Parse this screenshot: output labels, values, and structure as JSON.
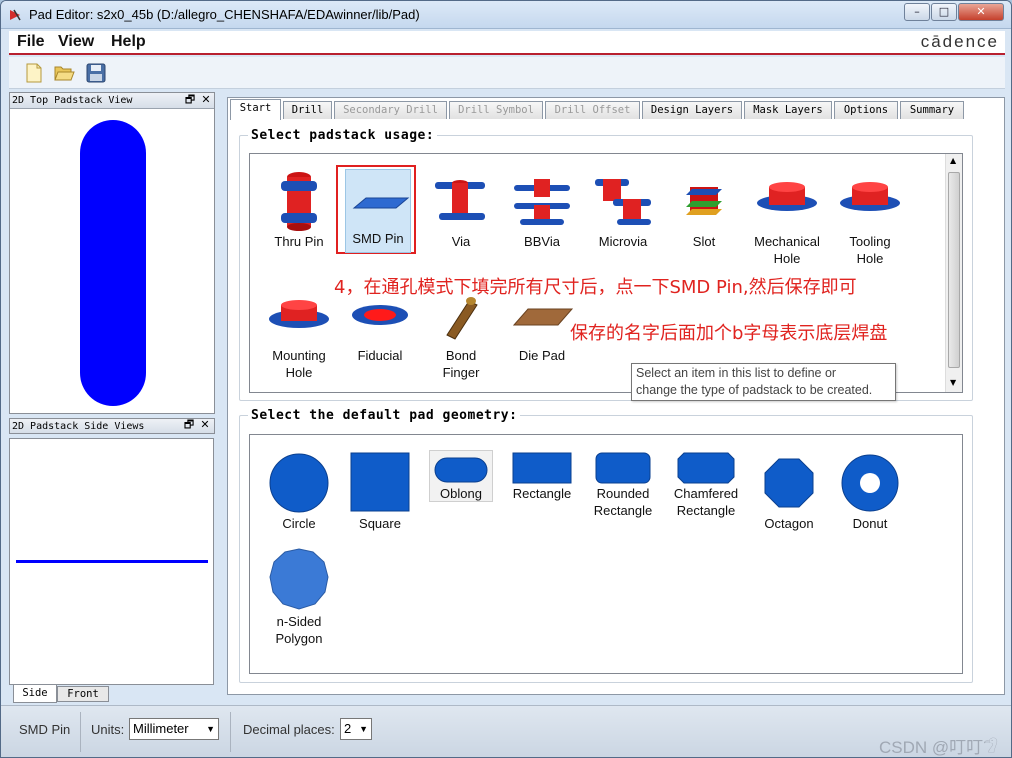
{
  "window": {
    "title": "Pad Editor: s2x0_45b  (D:/allegro_CHENSHAFA/EDAwinner/lib/Pad)",
    "minimize": "–",
    "maximize": "□",
    "close": "✕"
  },
  "menu": {
    "file": "File",
    "view": "View",
    "help": "Help",
    "brand": "cādence"
  },
  "toolbar": {
    "new_icon": "new-document-icon",
    "open_icon": "open-folder-icon",
    "save_icon": "save-disk-icon"
  },
  "top_view": {
    "title": "2D Top Padstack View",
    "restore": "🗗",
    "close": "✕",
    "pad_color": "#0000ff"
  },
  "side_view": {
    "title": "2D Padstack Side Views",
    "restore": "🗗",
    "close": "✕",
    "tabs": [
      "Side",
      "Front"
    ],
    "line_color": "#0000ff"
  },
  "tabs": [
    {
      "label": "Start",
      "state": "active"
    },
    {
      "label": "Drill",
      "state": "normal"
    },
    {
      "label": "Secondary Drill",
      "state": "disabled"
    },
    {
      "label": "Drill Symbol",
      "state": "disabled"
    },
    {
      "label": "Drill Offset",
      "state": "disabled"
    },
    {
      "label": "Design Layers",
      "state": "normal"
    },
    {
      "label": "Mask Layers",
      "state": "normal"
    },
    {
      "label": "Options",
      "state": "normal"
    },
    {
      "label": "Summary",
      "state": "normal"
    }
  ],
  "usage": {
    "title": "Select padstack usage:",
    "items": [
      {
        "l1": "Thru Pin",
        "l2": ""
      },
      {
        "l1": "SMD Pin",
        "l2": "",
        "selected": true
      },
      {
        "l1": "Via",
        "l2": ""
      },
      {
        "l1": "BBVia",
        "l2": ""
      },
      {
        "l1": "Microvia",
        "l2": ""
      },
      {
        "l1": "Slot",
        "l2": ""
      },
      {
        "l1": "Mechanical",
        "l2": "Hole"
      },
      {
        "l1": "Tooling",
        "l2": "Hole"
      },
      {
        "l1": "Mounting",
        "l2": "Hole"
      },
      {
        "l1": "Fiducial",
        "l2": ""
      },
      {
        "l1": "Bond",
        "l2": "Finger"
      },
      {
        "l1": "Die Pad",
        "l2": ""
      }
    ],
    "tooltip_line1": "Select an item in this list to define or",
    "tooltip_line2": "change the type of padstack to be created."
  },
  "annotations": {
    "line1": "4，在通孔模式下填完所有尺寸后，点一下SMD Pin,然后保存即可",
    "line2": "保存的名字后面加个b字母表示底层焊盘",
    "color": "#e0231f"
  },
  "geometry": {
    "title": "Select the default pad geometry:",
    "items": [
      {
        "l1": "Circle",
        "l2": ""
      },
      {
        "l1": "Square",
        "l2": ""
      },
      {
        "l1": "Oblong",
        "l2": "",
        "selected": true
      },
      {
        "l1": "Rectangle",
        "l2": ""
      },
      {
        "l1": "Rounded",
        "l2": "Rectangle"
      },
      {
        "l1": "Chamfered",
        "l2": "Rectangle"
      },
      {
        "l1": "Octagon",
        "l2": ""
      },
      {
        "l1": "Donut",
        "l2": ""
      },
      {
        "l1": "n-Sided",
        "l2": "Polygon"
      }
    ]
  },
  "status": {
    "mode": "SMD Pin",
    "units_label": "Units:",
    "units_value": "Millimeter",
    "decimal_label": "Decimal places:",
    "decimal_value": "2"
  },
  "watermark": "CSDN @叮叮𓅿"
}
